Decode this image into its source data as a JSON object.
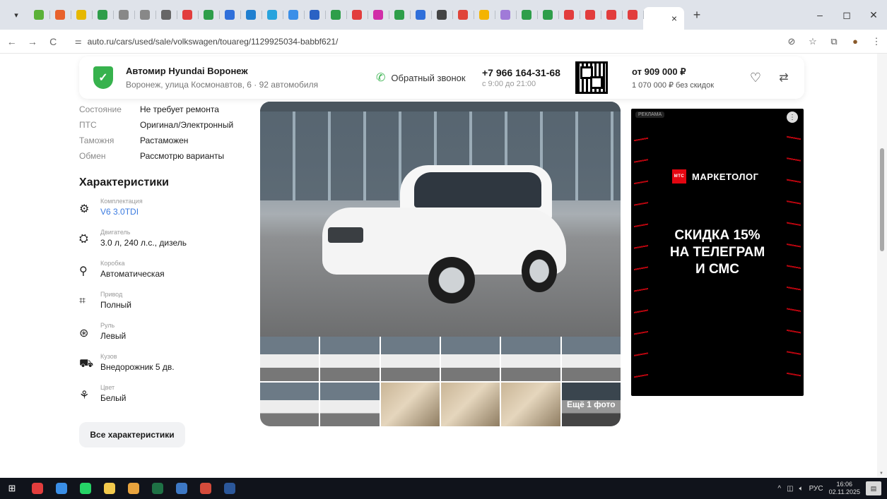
{
  "browser": {
    "menu_icon": "chevron-down-icon",
    "tabs": [
      {
        "icon": "yandex-market-icon",
        "color": "#5bb138"
      },
      {
        "icon": "heart-icon",
        "color": "#e8612c"
      },
      {
        "icon": "tv-icon",
        "color": "#e6b800"
      },
      {
        "icon": "green-plus-icon",
        "color": "#2e9e4a"
      },
      {
        "icon": "chrome-gray-icon",
        "color": "#888888"
      },
      {
        "icon": "chrome-gray-icon",
        "color": "#888888"
      },
      {
        "icon": "grid-icon",
        "color": "#666666"
      },
      {
        "icon": "red-circle-icon",
        "color": "#e23d3d"
      },
      {
        "icon": "green-c-icon",
        "color": "#2e9e4a"
      },
      {
        "icon": "settings-icon",
        "color": "#2f6fda"
      },
      {
        "icon": "blue-square-icon",
        "color": "#1f7fd0"
      },
      {
        "icon": "blue-dot-icon",
        "color": "#27a3dd"
      },
      {
        "icon": "blue-square-icon",
        "color": "#3b8fe8"
      },
      {
        "icon": "pin-icon",
        "color": "#2a62c4"
      },
      {
        "icon": "n-icon",
        "color": "#2e9e4a"
      },
      {
        "icon": "home-icon",
        "color": "#e23d3d"
      },
      {
        "icon": "flower-icon",
        "color": "#d12ea8"
      },
      {
        "icon": "globe-icon",
        "color": "#2e9e4a"
      },
      {
        "icon": "shield-icon",
        "color": "#2f6fda"
      },
      {
        "icon": "chart-icon",
        "color": "#444444"
      },
      {
        "icon": "slack-icon",
        "color": "#e0453a"
      },
      {
        "icon": "star-icon",
        "color": "#f4b400"
      },
      {
        "icon": "avatar-icon",
        "color": "#a07ad8"
      },
      {
        "icon": "green-plus-icon",
        "color": "#2e9e4a"
      },
      {
        "icon": "green-plus-icon",
        "color": "#2e9e4a"
      },
      {
        "icon": "red-rounded-icon",
        "color": "#e23d3d"
      },
      {
        "icon": "red-rounded-icon",
        "color": "#e23d3d"
      },
      {
        "icon": "red-rounded-icon",
        "color": "#e23d3d"
      },
      {
        "icon": "red-rounded-icon",
        "color": "#e23d3d"
      }
    ],
    "active_tab_close": "×",
    "new_tab": "+",
    "window_controls": {
      "minimize": "–",
      "maximize": "◻",
      "close": "✕"
    },
    "nav": {
      "back": "←",
      "forward": "→",
      "reload": "C"
    },
    "url": "auto.ru/cars/used/sale/volkswagen/touareg/1129925034-babbf621/",
    "toolbar_icons": {
      "eye_off": "⊘",
      "star": "☆",
      "extensions": "⧉",
      "profile": "●",
      "menu": "⋮"
    }
  },
  "dealer": {
    "name": "Автомир Hyundai Воронеж",
    "address": "Воронеж, улица Космонавтов, 6 · 92 автомобиля",
    "callback": "Обратный звонок",
    "phone": "+7 966 164-31-68",
    "hours": "с 9:00 до 21:00",
    "price": "от 909 000 ₽",
    "price_no_discount": "1 070 000 ₽ без скидок"
  },
  "overview": [
    {
      "key": "Состояние",
      "value": "Не требует ремонта"
    },
    {
      "key": "ПТС",
      "value": "Оригинал/Электронный"
    },
    {
      "key": "Таможня",
      "value": "Растаможен"
    },
    {
      "key": "Обмен",
      "value": "Рассмотрю варианты"
    }
  ],
  "specs_title": "Характеристики",
  "specs": [
    {
      "icon": "trim-icon",
      "glyph": "⚙",
      "label": "Комплектация",
      "value": "V6 3.0TDI",
      "link": true
    },
    {
      "icon": "engine-icon",
      "glyph": "⛭",
      "label": "Двигатель",
      "value": "3.0 л, 240 л.с., дизель",
      "link": false
    },
    {
      "icon": "gearbox-icon",
      "glyph": "⚲",
      "label": "Коробка",
      "value": "Автоматическая",
      "link": false
    },
    {
      "icon": "drive-icon",
      "glyph": "⌗",
      "label": "Привод",
      "value": "Полный",
      "link": false
    },
    {
      "icon": "steering-wheel-icon",
      "glyph": "⊛",
      "label": "Руль",
      "value": "Левый",
      "link": false
    },
    {
      "icon": "car-body-icon",
      "glyph": "⛟",
      "label": "Кузов",
      "value": "Внедорожник 5 дв.",
      "link": false
    },
    {
      "icon": "color-icon",
      "glyph": "⚘",
      "label": "Цвет",
      "value": "Белый",
      "link": false
    }
  ],
  "all_specs_button": "Все характеристики",
  "gallery": {
    "more_label": "Ещё 1 фото"
  },
  "ad": {
    "tag": "РЕКЛАМА",
    "logo_letters": "МТС",
    "brand": "МАРКЕТОЛОГ",
    "headline_1": "СКИДКА 15%",
    "headline_2": "НА ТЕЛЕГРАМ",
    "headline_3": "И СМС"
  },
  "taskbar": {
    "apps": [
      {
        "icon": "yandex-browser-icon",
        "color": "#e23d3d"
      },
      {
        "icon": "cloud-icon",
        "color": "#3a8ee6"
      },
      {
        "icon": "whatsapp-icon",
        "color": "#25d366"
      },
      {
        "icon": "file-explorer-icon",
        "color": "#f2c94c"
      },
      {
        "icon": "chrome-icon",
        "color": "#e8a33d"
      },
      {
        "icon": "excel-icon",
        "color": "#1e7145"
      },
      {
        "icon": "app-icon",
        "color": "#3d78c5"
      },
      {
        "icon": "browser-icon",
        "color": "#d44b3b"
      },
      {
        "icon": "word-icon",
        "color": "#2b579a"
      }
    ],
    "lang": "РУС",
    "time": "16:06",
    "date": "02.11.2025"
  }
}
